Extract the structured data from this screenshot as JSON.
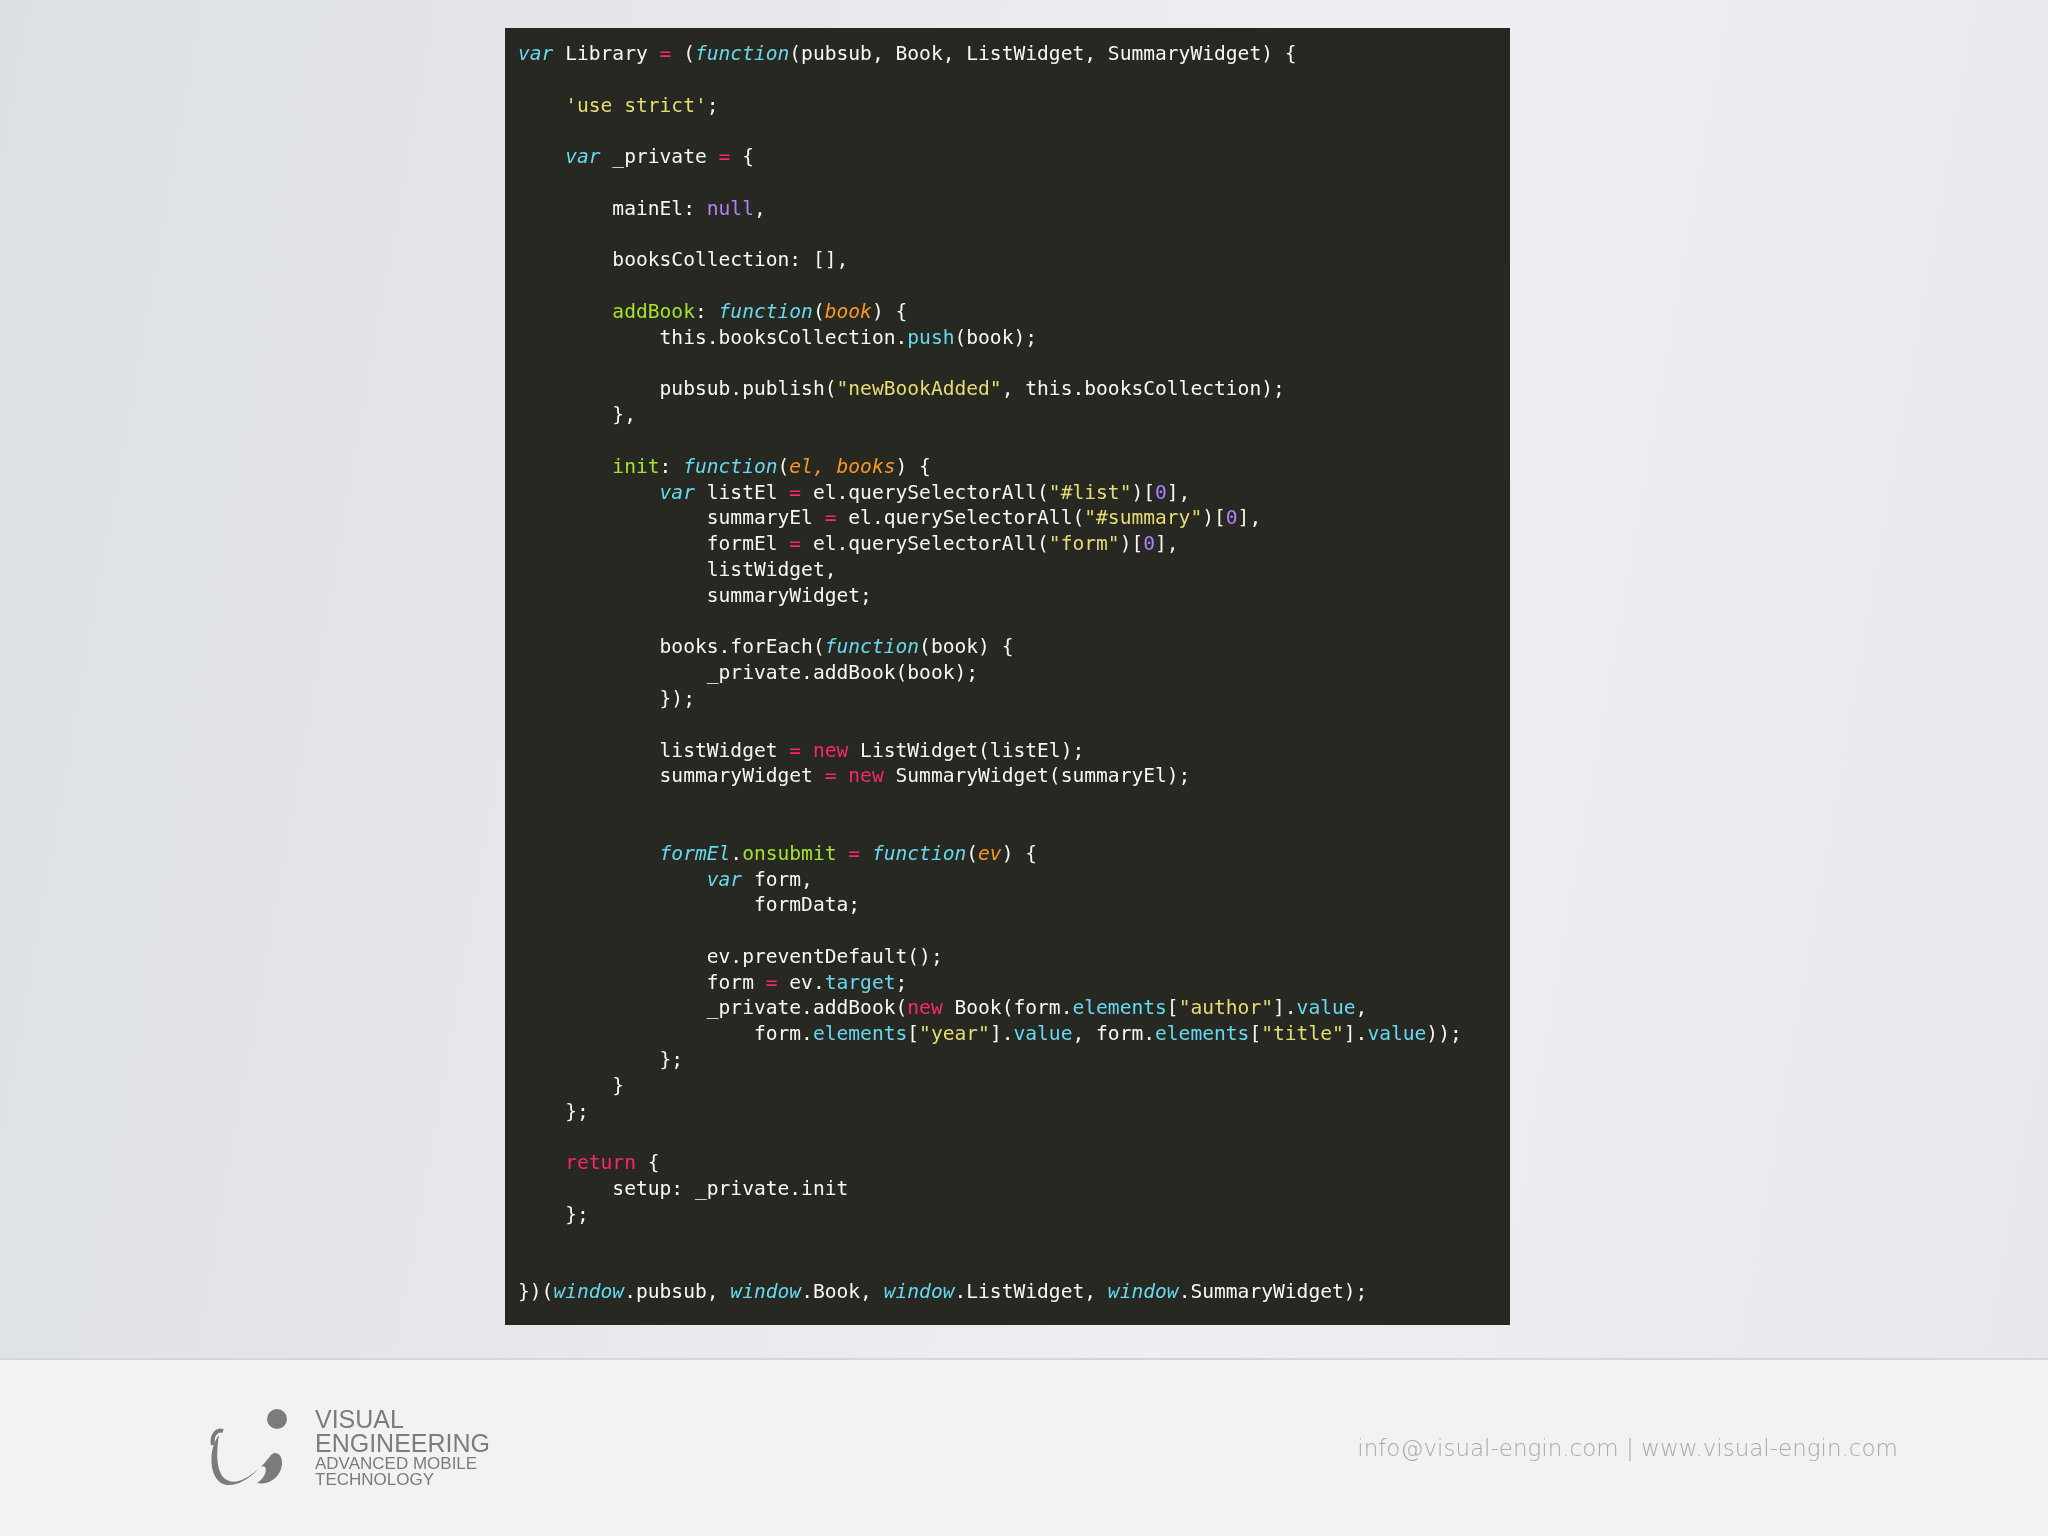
{
  "code_panel": {
    "lines": [
      {
        "kind": "code",
        "tokens": [
          {
            "text": "var",
            "kind": "storage"
          },
          {
            "text": " Library ",
            "kind": "plain"
          },
          {
            "text": "=",
            "kind": "operator"
          },
          {
            "text": " (",
            "kind": "plain"
          },
          {
            "text": "function",
            "kind": "storage"
          },
          {
            "text": "(pubsub, Book, ListWidget, SummaryWidget) {",
            "kind": "plain"
          }
        ]
      },
      {
        "kind": "blank"
      },
      {
        "kind": "code",
        "tokens": [
          {
            "text": "    'use strict'",
            "kind": "string"
          },
          {
            "text": ";",
            "kind": "plain"
          }
        ]
      },
      {
        "kind": "blank"
      },
      {
        "kind": "code",
        "tokens": [
          {
            "text": "    var",
            "kind": "storage"
          },
          {
            "text": " _private ",
            "kind": "plain"
          },
          {
            "text": "=",
            "kind": "operator"
          },
          {
            "text": " {",
            "kind": "plain"
          }
        ]
      },
      {
        "kind": "blank"
      },
      {
        "kind": "code",
        "tokens": [
          {
            "text": "        mainEl: ",
            "kind": "plain"
          },
          {
            "text": "null",
            "kind": "constant"
          },
          {
            "text": ",",
            "kind": "plain"
          }
        ]
      },
      {
        "kind": "blank"
      },
      {
        "kind": "code",
        "tokens": [
          {
            "text": "        booksCollection: [],",
            "kind": "plain"
          }
        ]
      },
      {
        "kind": "blank"
      },
      {
        "kind": "code",
        "tokens": [
          {
            "text": "        addBook",
            "kind": "entity"
          },
          {
            "text": ": ",
            "kind": "plain"
          },
          {
            "text": "function",
            "kind": "storage"
          },
          {
            "text": "(",
            "kind": "plain"
          },
          {
            "text": "book",
            "kind": "param"
          },
          {
            "text": ") {",
            "kind": "plain"
          }
        ]
      },
      {
        "kind": "code",
        "tokens": [
          {
            "text": "            this.booksCollection.",
            "kind": "plain"
          },
          {
            "text": "push",
            "kind": "support"
          },
          {
            "text": "(book);",
            "kind": "plain"
          }
        ]
      },
      {
        "kind": "blank"
      },
      {
        "kind": "code",
        "tokens": [
          {
            "text": "            pubsub.publish(",
            "kind": "plain"
          },
          {
            "text": "\"newBookAdded\"",
            "kind": "string"
          },
          {
            "text": ", this.booksCollection);",
            "kind": "plain"
          }
        ]
      },
      {
        "kind": "code",
        "tokens": [
          {
            "text": "        },",
            "kind": "plain"
          }
        ]
      },
      {
        "kind": "blank"
      },
      {
        "kind": "code",
        "tokens": [
          {
            "text": "        init",
            "kind": "entity"
          },
          {
            "text": ": ",
            "kind": "plain"
          },
          {
            "text": "function",
            "kind": "storage"
          },
          {
            "text": "(",
            "kind": "plain"
          },
          {
            "text": "el, books",
            "kind": "param"
          },
          {
            "text": ") {",
            "kind": "plain"
          }
        ]
      },
      {
        "kind": "code",
        "tokens": [
          {
            "text": "            var",
            "kind": "storage"
          },
          {
            "text": " listEl ",
            "kind": "plain"
          },
          {
            "text": "=",
            "kind": "operator"
          },
          {
            "text": " el.querySelectorAll(",
            "kind": "plain"
          },
          {
            "text": "\"#list\"",
            "kind": "string"
          },
          {
            "text": ")[",
            "kind": "plain"
          },
          {
            "text": "0",
            "kind": "constant"
          },
          {
            "text": "],",
            "kind": "plain"
          }
        ]
      },
      {
        "kind": "code",
        "tokens": [
          {
            "text": "                summaryEl ",
            "kind": "plain"
          },
          {
            "text": "=",
            "kind": "operator"
          },
          {
            "text": " el.querySelectorAll(",
            "kind": "plain"
          },
          {
            "text": "\"#summary\"",
            "kind": "string"
          },
          {
            "text": ")[",
            "kind": "plain"
          },
          {
            "text": "0",
            "kind": "constant"
          },
          {
            "text": "],",
            "kind": "plain"
          }
        ]
      },
      {
        "kind": "code",
        "tokens": [
          {
            "text": "                formEl ",
            "kind": "plain"
          },
          {
            "text": "=",
            "kind": "operator"
          },
          {
            "text": " el.querySelectorAll(",
            "kind": "plain"
          },
          {
            "text": "\"form\"",
            "kind": "string"
          },
          {
            "text": ")[",
            "kind": "plain"
          },
          {
            "text": "0",
            "kind": "constant"
          },
          {
            "text": "],",
            "kind": "plain"
          }
        ]
      },
      {
        "kind": "code",
        "tokens": [
          {
            "text": "                listWidget,",
            "kind": "plain"
          }
        ]
      },
      {
        "kind": "code",
        "tokens": [
          {
            "text": "                summaryWidget;",
            "kind": "plain"
          }
        ]
      },
      {
        "kind": "blank"
      },
      {
        "kind": "code",
        "tokens": [
          {
            "text": "            books.forEach(",
            "kind": "plain"
          },
          {
            "text": "function",
            "kind": "storage"
          },
          {
            "text": "(book) {",
            "kind": "plain"
          }
        ]
      },
      {
        "kind": "code",
        "tokens": [
          {
            "text": "                _private.addBook(book);",
            "kind": "plain"
          }
        ]
      },
      {
        "kind": "code",
        "tokens": [
          {
            "text": "            });",
            "kind": "plain"
          }
        ]
      },
      {
        "kind": "blank"
      },
      {
        "kind": "code",
        "tokens": [
          {
            "text": "            listWidget ",
            "kind": "plain"
          },
          {
            "text": "= new",
            "kind": "operator"
          },
          {
            "text": " ListWidget(listEl);",
            "kind": "plain"
          }
        ]
      },
      {
        "kind": "code",
        "tokens": [
          {
            "text": "            summaryWidget ",
            "kind": "plain"
          },
          {
            "text": "= new",
            "kind": "operator"
          },
          {
            "text": " SummaryWidget(summaryEl);",
            "kind": "plain"
          }
        ]
      },
      {
        "kind": "blank"
      },
      {
        "kind": "blank"
      },
      {
        "kind": "code",
        "tokens": [
          {
            "text": "            formEl",
            "kind": "storage"
          },
          {
            "text": ".",
            "kind": "plain"
          },
          {
            "text": "onsubmit",
            "kind": "entity"
          },
          {
            "text": " = ",
            "kind": "operator"
          },
          {
            "text": "function",
            "kind": "storage"
          },
          {
            "text": "(",
            "kind": "plain"
          },
          {
            "text": "ev",
            "kind": "param"
          },
          {
            "text": ") {",
            "kind": "plain"
          }
        ]
      },
      {
        "kind": "code",
        "tokens": [
          {
            "text": "                var",
            "kind": "storage"
          },
          {
            "text": " form,",
            "kind": "plain"
          }
        ]
      },
      {
        "kind": "code",
        "tokens": [
          {
            "text": "                    formData;",
            "kind": "plain"
          }
        ]
      },
      {
        "kind": "blank"
      },
      {
        "kind": "code",
        "tokens": [
          {
            "text": "                ev.preventDefault();",
            "kind": "plain"
          }
        ]
      },
      {
        "kind": "code",
        "tokens": [
          {
            "text": "                form ",
            "kind": "plain"
          },
          {
            "text": "=",
            "kind": "operator"
          },
          {
            "text": " ev.",
            "kind": "plain"
          },
          {
            "text": "target",
            "kind": "support"
          },
          {
            "text": ";",
            "kind": "plain"
          }
        ]
      },
      {
        "kind": "code",
        "tokens": [
          {
            "text": "                _private.addBook(",
            "kind": "plain"
          },
          {
            "text": "new",
            "kind": "keyword"
          },
          {
            "text": " Book(form.",
            "kind": "plain"
          },
          {
            "text": "elements",
            "kind": "support"
          },
          {
            "text": "[",
            "kind": "plain"
          },
          {
            "text": "\"author\"",
            "kind": "string"
          },
          {
            "text": "].",
            "kind": "plain"
          },
          {
            "text": "value",
            "kind": "support"
          },
          {
            "text": ",",
            "kind": "plain"
          }
        ]
      },
      {
        "kind": "code",
        "tokens": [
          {
            "text": "                    form.",
            "kind": "plain"
          },
          {
            "text": "elements",
            "kind": "support"
          },
          {
            "text": "[",
            "kind": "plain"
          },
          {
            "text": "\"year\"",
            "kind": "string"
          },
          {
            "text": "].",
            "kind": "plain"
          },
          {
            "text": "value",
            "kind": "support"
          },
          {
            "text": ", form.",
            "kind": "plain"
          },
          {
            "text": "elements",
            "kind": "support"
          },
          {
            "text": "[",
            "kind": "plain"
          },
          {
            "text": "\"title\"",
            "kind": "string"
          },
          {
            "text": "].",
            "kind": "plain"
          },
          {
            "text": "value",
            "kind": "support"
          },
          {
            "text": "));",
            "kind": "plain"
          }
        ]
      },
      {
        "kind": "code",
        "tokens": [
          {
            "text": "            };",
            "kind": "plain"
          }
        ]
      },
      {
        "kind": "code",
        "tokens": [
          {
            "text": "        }",
            "kind": "plain"
          }
        ]
      },
      {
        "kind": "code",
        "tokens": [
          {
            "text": "    };",
            "kind": "plain"
          }
        ]
      },
      {
        "kind": "blank"
      },
      {
        "kind": "code",
        "tokens": [
          {
            "text": "    return",
            "kind": "keyword"
          },
          {
            "text": " {",
            "kind": "plain"
          }
        ]
      },
      {
        "kind": "code",
        "tokens": [
          {
            "text": "        setup: _private.init",
            "kind": "plain"
          }
        ]
      },
      {
        "kind": "code",
        "tokens": [
          {
            "text": "    };",
            "kind": "plain"
          }
        ]
      },
      {
        "kind": "blank"
      },
      {
        "kind": "blank"
      },
      {
        "kind": "code",
        "tokens": [
          {
            "text": "})(",
            "kind": "plain"
          },
          {
            "text": "window",
            "kind": "storage"
          },
          {
            "text": ".pubsub, ",
            "kind": "plain"
          },
          {
            "text": "window",
            "kind": "storage"
          },
          {
            "text": ".Book, ",
            "kind": "plain"
          },
          {
            "text": "window",
            "kind": "storage"
          },
          {
            "text": ".ListWidget, ",
            "kind": "plain"
          },
          {
            "text": "window",
            "kind": "storage"
          },
          {
            "text": ".SummaryWidget);",
            "kind": "plain"
          }
        ]
      }
    ]
  },
  "footer": {
    "logo_lines": [
      "VISUAL",
      "ENGINEERING",
      "ADVANCED MOBILE",
      "TECHNOLOGY"
    ],
    "contact": "info@visual-engin.com | www.visual-engin.com"
  }
}
